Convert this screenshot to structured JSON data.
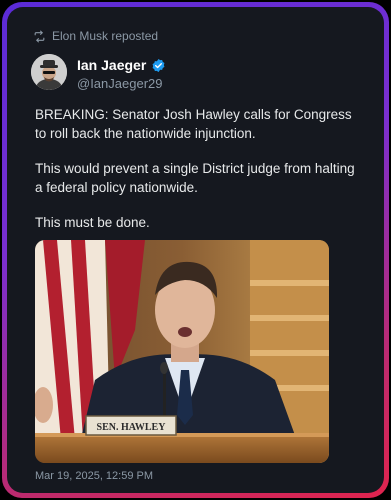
{
  "repost": {
    "label": "Elon Musk reposted",
    "icon": "retweet-icon"
  },
  "author": {
    "name": "Ian Jaeger",
    "handle": "@IanJaeger29",
    "verified_icon": "verified-badge-icon",
    "avatar_icon": "avatar-icon"
  },
  "post": {
    "paragraphs": [
      "BREAKING: Senator Josh Hawley calls for Congress to roll back the nationwide injunction.",
      "This would prevent a single District judge from halting a federal policy nationwide.",
      "This must be done."
    ],
    "media": {
      "nameplate": "SEN. HAWLEY"
    },
    "timestamp": "Mar 19, 2025, 12:59 PM"
  },
  "colors": {
    "card_bg": "#15181f",
    "frame_start": "#5b2bd6",
    "frame_end": "#e0244e",
    "secondary_text": "#8b98a5",
    "verified_blue": "#1d9bf0"
  }
}
